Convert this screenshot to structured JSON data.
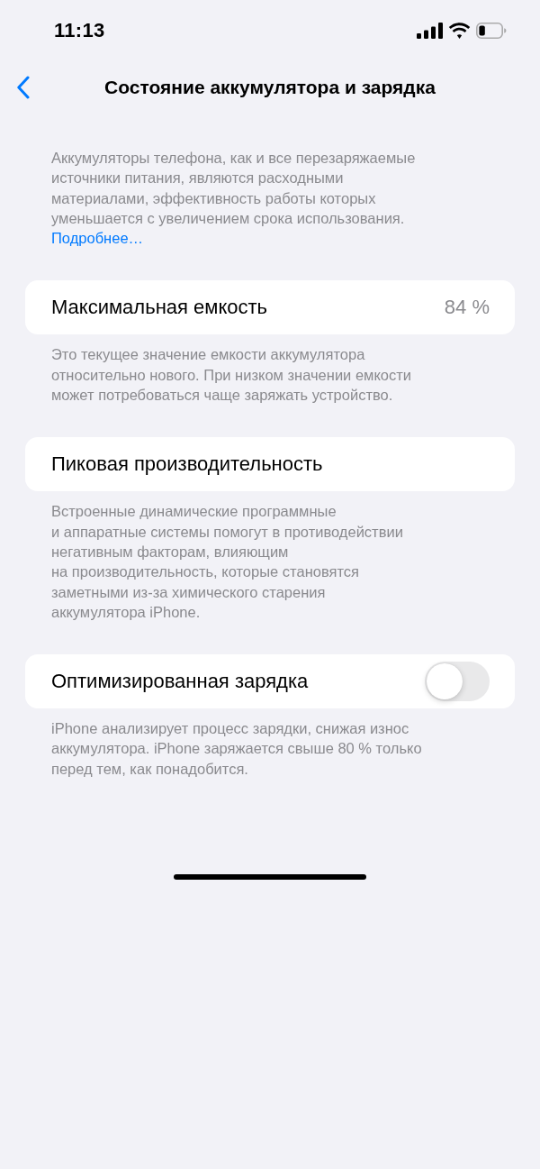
{
  "status_bar": {
    "time": "11:13"
  },
  "nav": {
    "title": "Состояние аккумулятора и зарядка"
  },
  "intro": {
    "text": "Аккумуляторы телефона, как и все перезаряжаемые\nисточники питания, являются расходными\nматериалами, эффективность работы которых\nуменьшается с увеличением срока использования.",
    "link": "Подробнее…"
  },
  "sections": [
    {
      "kind": "value",
      "label": "Максимальная емкость",
      "value": "84 %",
      "footer": "Это текущее значение емкости аккумулятора\nотносительно нового. При низком значении емкости\nможет потребоваться чаще заряжать устройство."
    },
    {
      "kind": "plain",
      "label": "Пиковая производительность",
      "footer": "Встроенные динамические программные\nи аппаратные системы помогут в противодействии\nнегативным факторам, влияющим\nна производительность, которые становятся\nзаметными из-за химического старения\nаккумулятора iPhone."
    },
    {
      "kind": "toggle",
      "label": "Оптимизированная зарядка",
      "on": false,
      "footer": "iPhone анализирует процесс зарядки, снижая износ\nаккумулятора. iPhone заряжается свыше 80 % только\nперед тем, как понадобится."
    }
  ]
}
